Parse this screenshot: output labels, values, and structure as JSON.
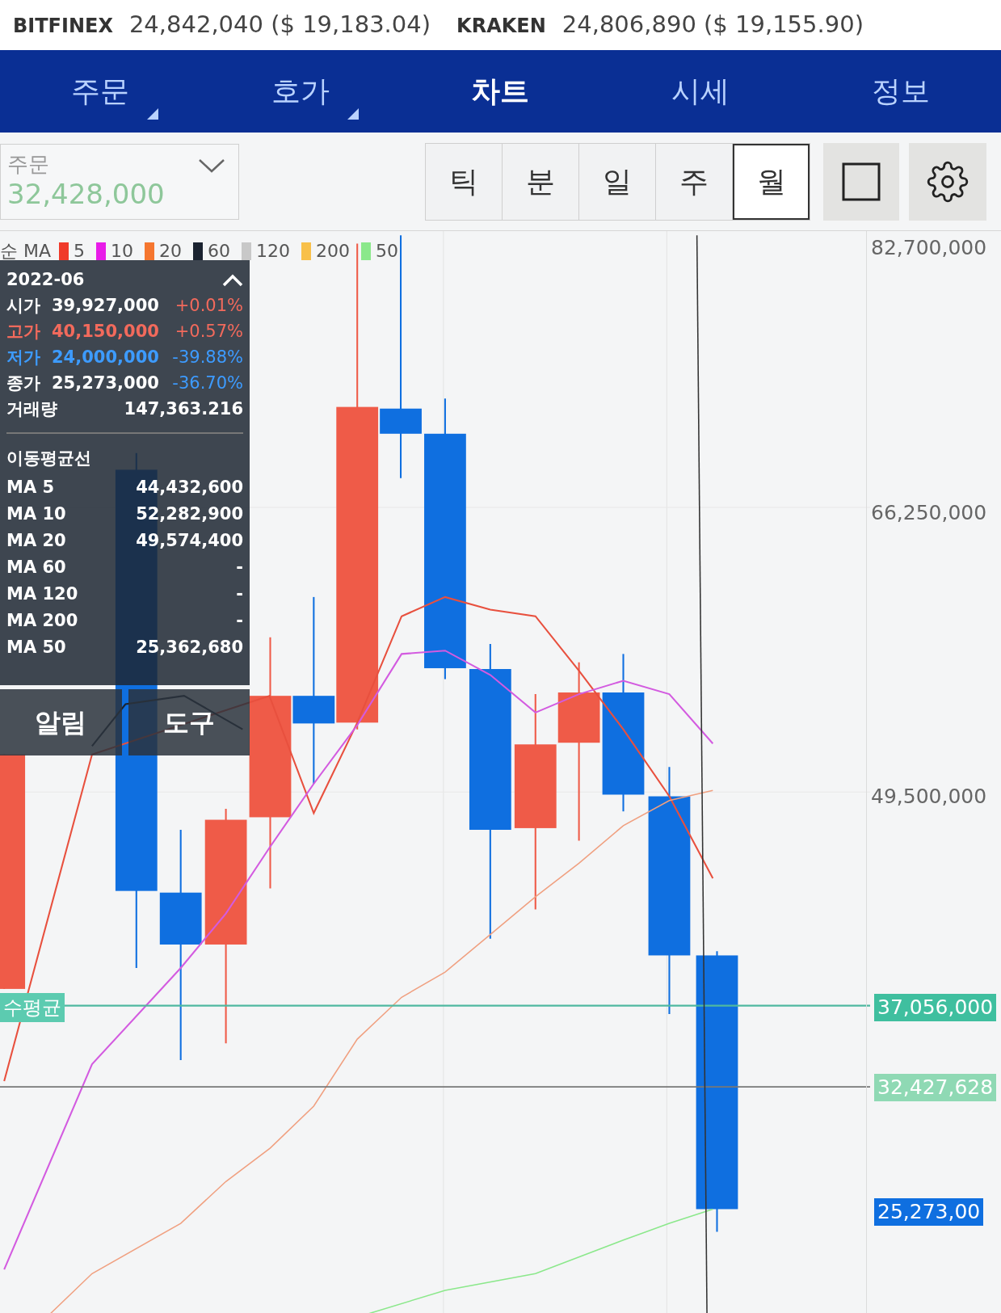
{
  "quotes": [
    {
      "exchange": "BITFINEX",
      "price": "24,842,040 ($ 19,183.04)"
    },
    {
      "exchange": "KRAKEN",
      "price": "24,806,890 ($ 19,155.90)"
    }
  ],
  "nav_tabs": [
    {
      "label": "주문",
      "selected": false,
      "has_menu": true
    },
    {
      "label": "호가",
      "selected": false,
      "has_menu": true
    },
    {
      "label": "차트",
      "selected": true,
      "has_menu": false
    },
    {
      "label": "시세",
      "selected": false,
      "has_menu": false
    },
    {
      "label": "정보",
      "selected": false,
      "has_menu": false
    }
  ],
  "order_select": {
    "label": "주문",
    "value": "32,428,000"
  },
  "periods": [
    {
      "label": "틱",
      "selected": false
    },
    {
      "label": "분",
      "selected": false
    },
    {
      "label": "일",
      "selected": false
    },
    {
      "label": "주",
      "selected": false
    },
    {
      "label": "월",
      "selected": true
    }
  ],
  "legend": {
    "label": "순 MA",
    "items": [
      {
        "label": "5",
        "color": "#f03a2a"
      },
      {
        "label": "10",
        "color": "#e81ce8"
      },
      {
        "label": "20",
        "color": "#f5762f"
      },
      {
        "label": "60",
        "color": "#1b2330"
      },
      {
        "label": "120",
        "color": "#c8c8c8"
      },
      {
        "label": "200",
        "color": "#f8c04a"
      },
      {
        "label": "50",
        "color": "#8be88b"
      }
    ]
  },
  "y_axis": [
    "82,700,000",
    "66,250,000",
    "49,500,000"
  ],
  "price_tags": [
    {
      "kind": "average",
      "value": "37,056,000"
    },
    {
      "kind": "order",
      "value": "32,427,628"
    },
    {
      "kind": "current",
      "value": "25,273,00"
    }
  ],
  "average_label": "수평균",
  "info_panel": {
    "period": "2022-06",
    "rows": [
      {
        "label": "시가",
        "value": "39,927,000",
        "color": "#ffffff",
        "change": {
          "text": "+0.01%",
          "color": "#f26a5c"
        }
      },
      {
        "label": "고가",
        "value": "40,150,000",
        "color": "#f26a5c",
        "change": {
          "text": "+0.57%",
          "color": "#f26a5c"
        }
      },
      {
        "label": "저가",
        "value": "24,000,000",
        "color": "#3d9bff",
        "change": {
          "text": "-39.88%",
          "color": "#3d9bff"
        }
      },
      {
        "label": "종가",
        "value": "25,273,000",
        "color": "#ffffff",
        "change": {
          "text": "-36.70%",
          "color": "#3d9bff"
        }
      }
    ],
    "volume": {
      "label": "거래량",
      "value": "147,363.216"
    },
    "ma_title": "이동평균선",
    "ma_rows": [
      {
        "label": "MA 5",
        "value": "44,432,600"
      },
      {
        "label": "MA 10",
        "value": "52,282,900"
      },
      {
        "label": "MA 20",
        "value": "49,574,400"
      },
      {
        "label": "MA 60",
        "value": "-"
      },
      {
        "label": "MA 120",
        "value": "-"
      },
      {
        "label": "MA 200",
        "value": "-"
      },
      {
        "label": "MA 50",
        "value": "25,362,680"
      }
    ]
  },
  "panel_buttons": [
    "알림",
    "도구"
  ]
}
